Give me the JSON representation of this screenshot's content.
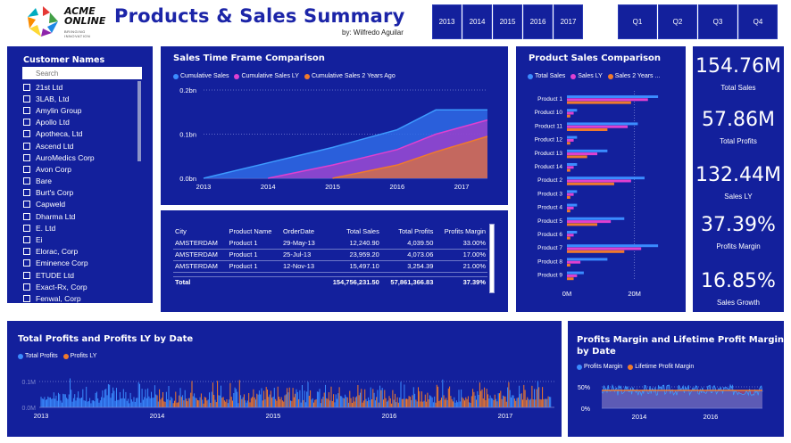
{
  "header": {
    "title": "Products & Sales Summary",
    "byline": "by: Wilfredo Aguilar",
    "logo_line1": "ACME",
    "logo_line2": "ONLINE",
    "logo_sub": "BRINGING INNOVATION"
  },
  "year_slicers": [
    "2013",
    "2014",
    "2015",
    "2016",
    "2017"
  ],
  "quarter_slicers": [
    "Q1",
    "Q2",
    "Q3",
    "Q4"
  ],
  "customer_panel": {
    "title": "Customer Names",
    "search_placeholder": "Search",
    "items": [
      "21st Ltd",
      "3LAB, Ltd",
      "Amylin Group",
      "Apollo Ltd",
      "Apotheca, Ltd",
      "Ascend Ltd",
      "AuroMedics Corp",
      "Avon Corp",
      "Bare",
      "Burt's Corp",
      "Capweld",
      "Dharma Ltd",
      "E. Ltd",
      "Ei",
      "Elorac, Corp",
      "Eminence Corp",
      "ETUDE Ltd",
      "Exact-Rx, Corp",
      "Fenwal, Corp"
    ]
  },
  "sales_timeframe": {
    "title": "Sales Time Frame Comparison",
    "legend": [
      {
        "label": "Cumulative Sales",
        "color": "#3b8cff"
      },
      {
        "label": "Cumulative Sales LY",
        "color": "#e040d0"
      },
      {
        "label": "Cumulative Sales 2 Years Ago",
        "color": "#f07a2c"
      }
    ],
    "y_ticks": [
      "0.2bn",
      "0.1bn",
      "0.0bn"
    ],
    "x_ticks": [
      "2013",
      "2014",
      "2015",
      "2016",
      "2017"
    ]
  },
  "orders_table": {
    "columns": [
      "City",
      "Product Name",
      "OrderDate",
      "Total Sales",
      "Total Profits",
      "Profits Margin"
    ],
    "rows": [
      [
        "AMSTERDAM",
        "Product 1",
        "29-May-13",
        "12,240.90",
        "4,039.50",
        "33.00%"
      ],
      [
        "AMSTERDAM",
        "Product 1",
        "25-Jul-13",
        "23,959.20",
        "4,073.06",
        "17.00%"
      ],
      [
        "AMSTERDAM",
        "Product 1",
        "12-Nov-13",
        "15,497.10",
        "3,254.39",
        "21.00%"
      ]
    ],
    "total_label": "Total",
    "total_sales": "154,756,231.50",
    "total_profits": "57,861,366.83",
    "total_margin": "37.39%"
  },
  "product_comparison": {
    "title": "Product Sales Comparison",
    "legend": [
      {
        "label": "Total Sales",
        "color": "#3b8cff"
      },
      {
        "label": "Sales LY",
        "color": "#e040d0"
      },
      {
        "label": "Sales 2 Years ...",
        "color": "#f07a2c"
      }
    ],
    "x_ticks": [
      "0M",
      "20M"
    ]
  },
  "kpis": [
    {
      "value": "154.76M",
      "label": "Total Sales"
    },
    {
      "value": "57.86M",
      "label": "Total Profits"
    },
    {
      "value": "132.44M",
      "label": "Sales LY"
    },
    {
      "value": "37.39%",
      "label": "Profits Margin"
    },
    {
      "value": "16.85%",
      "label": "Sales Growth"
    }
  ],
  "profits_by_date": {
    "title": "Total Profits and Profits LY by Date",
    "legend": [
      {
        "label": "Total Profits",
        "color": "#3b8cff"
      },
      {
        "label": "Profits LY",
        "color": "#f07a2c"
      }
    ],
    "y_ticks": [
      "0.1M",
      "0.0M"
    ],
    "x_ticks": [
      "2013",
      "2014",
      "2015",
      "2016",
      "2017"
    ]
  },
  "margin_by_date": {
    "title_line1": "Profits Margin and Lifetime Profit Margin",
    "title_line2": "by Date",
    "legend": [
      {
        "label": "Profits Margin",
        "color": "#3b8cff"
      },
      {
        "label": "Lifetime Profit Margin",
        "color": "#f07a2c"
      }
    ],
    "y_ticks": [
      "50%",
      "0%"
    ],
    "x_ticks": [
      "2014",
      "2016"
    ]
  },
  "chart_data": [
    {
      "type": "bar",
      "title": "Product Sales Comparison",
      "orientation": "horizontal",
      "categories": [
        "Product 1",
        "Product 10",
        "Product 11",
        "Product 12",
        "Product 13",
        "Product 14",
        "Product 2",
        "Product 3",
        "Product 4",
        "Product 5",
        "Product 6",
        "Product 7",
        "Product 8",
        "Product 9"
      ],
      "series": [
        {
          "name": "Total Sales",
          "values": [
            27,
            3,
            21,
            3,
            12,
            3,
            23,
            3,
            3,
            17,
            3,
            27,
            12,
            5
          ]
        },
        {
          "name": "Sales LY",
          "values": [
            24,
            2,
            18,
            2,
            9,
            2,
            19,
            2,
            2,
            13,
            2,
            22,
            4,
            3
          ]
        },
        {
          "name": "Sales 2 Years ...",
          "values": [
            19,
            1,
            12,
            1,
            6,
            1,
            14,
            1,
            1,
            9,
            1,
            17,
            1,
            2
          ]
        }
      ],
      "xlim": [
        0,
        32
      ],
      "x_ticks": [
        "0M",
        "20M"
      ]
    },
    {
      "type": "area",
      "title": "Sales Time Frame Comparison",
      "x": [
        2013,
        2014,
        2015,
        2016,
        2016.6,
        2017.4
      ],
      "series": [
        {
          "name": "Cumulative Sales",
          "values": [
            0.0,
            0.035,
            0.07,
            0.11,
            0.155,
            0.155
          ]
        },
        {
          "name": "Cumulative Sales LY",
          "values": [
            null,
            0.0,
            0.03,
            0.065,
            0.1,
            0.132
          ]
        },
        {
          "name": "Cumulative Sales 2 Years Ago",
          "values": [
            null,
            null,
            0.0,
            0.03,
            0.06,
            0.095
          ]
        }
      ],
      "ylim": [
        0,
        0.2
      ],
      "y_ticks": [
        "0.0bn",
        "0.1bn",
        "0.2bn"
      ]
    }
  ]
}
